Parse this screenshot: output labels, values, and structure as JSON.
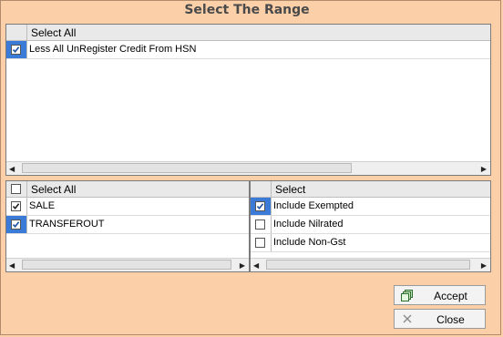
{
  "dialog": {
    "title": "Select The Range"
  },
  "top_list": {
    "header": "Select All",
    "items": [
      {
        "label": "Less All UnRegister Credit From HSN",
        "checked": true
      }
    ]
  },
  "left_list": {
    "header": "Select All",
    "header_checked": false,
    "items": [
      {
        "label": "SALE",
        "checked": true
      },
      {
        "label": "TRANSFEROUT",
        "checked": true
      }
    ]
  },
  "right_list": {
    "header": "Select",
    "items": [
      {
        "label": "Include Exempted",
        "checked": true
      },
      {
        "label": "Include Nilrated",
        "checked": false
      },
      {
        "label": "Include Non-Gst",
        "checked": false
      }
    ]
  },
  "buttons": {
    "accept": "Accept",
    "close": "Close"
  },
  "icons": {
    "accept": "copy-icon",
    "close": "x-icon"
  },
  "colors": {
    "background": "#fbcfa8",
    "selection": "#3b7ad6"
  }
}
